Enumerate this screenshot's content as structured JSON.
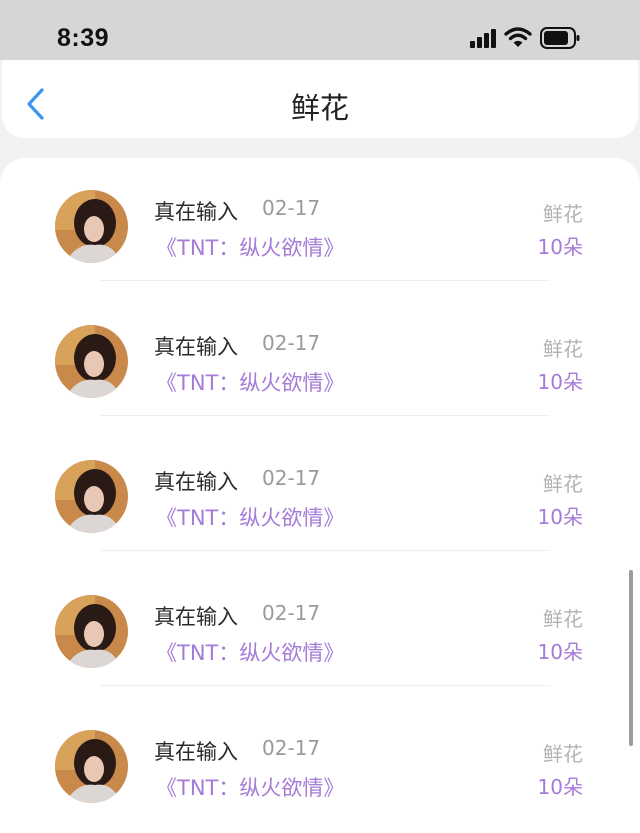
{
  "status_bar": {
    "time": "8:39",
    "icons": [
      "cellular-signal-icon",
      "wifi-icon",
      "battery-icon"
    ]
  },
  "nav": {
    "title": "鲜花",
    "back_icon": "chevron-left-icon"
  },
  "colors": {
    "accent_purple": "#a67bd8",
    "back_blue": "#3d95f0"
  },
  "list": [
    {
      "name": "真在输入",
      "date": "02-17",
      "work": "《TNT：纵火欲情》",
      "gift": "鲜花",
      "quantity": "10朵"
    },
    {
      "name": "真在输入",
      "date": "02-17",
      "work": "《TNT：纵火欲情》",
      "gift": "鲜花",
      "quantity": "10朵"
    },
    {
      "name": "真在输入",
      "date": "02-17",
      "work": "《TNT：纵火欲情》",
      "gift": "鲜花",
      "quantity": "10朵"
    },
    {
      "name": "真在输入",
      "date": "02-17",
      "work": "《TNT：纵火欲情》",
      "gift": "鲜花",
      "quantity": "10朵"
    },
    {
      "name": "真在输入",
      "date": "02-17",
      "work": "《TNT：纵火欲情》",
      "gift": "鲜花",
      "quantity": "10朵"
    }
  ]
}
